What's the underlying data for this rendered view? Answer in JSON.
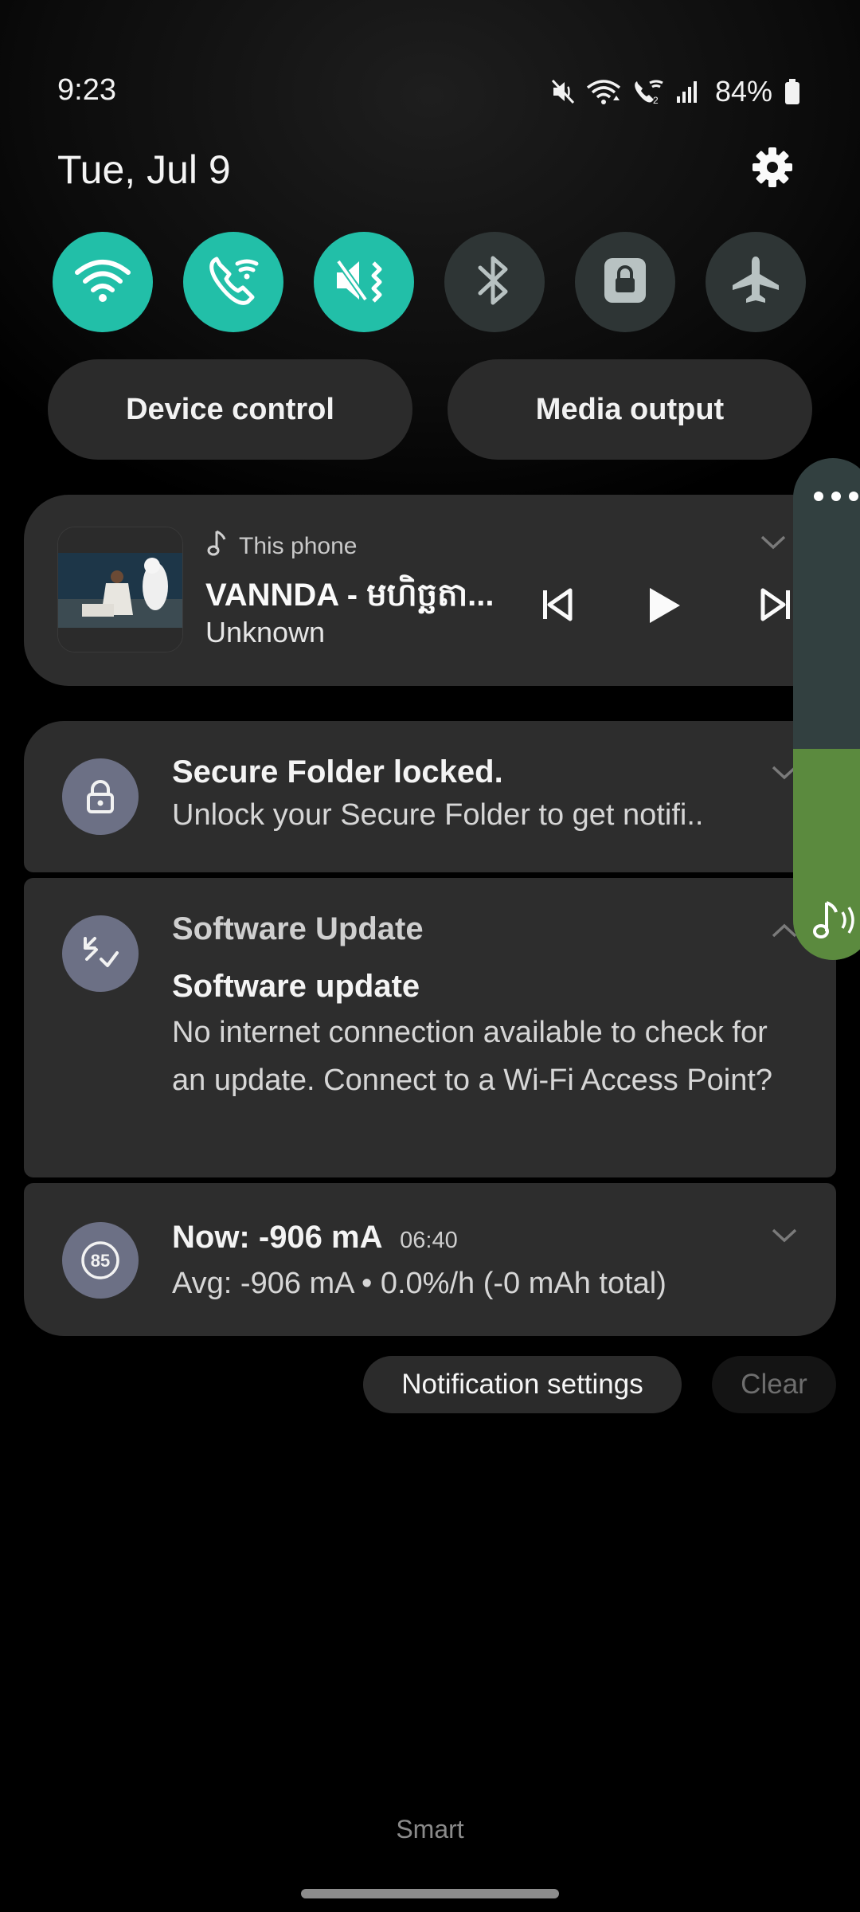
{
  "status_bar": {
    "time": "9:23",
    "battery": "84%",
    "icons": [
      "mute-icon",
      "wifi-icon",
      "wifi-calling-icon",
      "signal-icon",
      "battery-icon"
    ]
  },
  "header": {
    "date": "Tue, Jul 9",
    "settings_icon": "gear-icon"
  },
  "quick_toggles": [
    {
      "name": "Wi-Fi",
      "icon": "wifi-icon",
      "state": "on"
    },
    {
      "name": "Wi-Fi Calling",
      "icon": "wifi-calling-icon",
      "state": "on"
    },
    {
      "name": "Mute",
      "icon": "mute-icon",
      "state": "on"
    },
    {
      "name": "Bluetooth",
      "icon": "bluetooth-icon",
      "state": "off"
    },
    {
      "name": "Secure Folder",
      "icon": "lock-icon",
      "state": "off"
    },
    {
      "name": "Airplane mode",
      "icon": "airplane-icon",
      "state": "off"
    }
  ],
  "buttons": {
    "device_control": "Device control",
    "media_output": "Media output"
  },
  "media": {
    "source": "This phone",
    "title": "VANNDA - មហិច្ឆតា...",
    "artist": "Unknown"
  },
  "notifications": {
    "secure_folder": {
      "title": "Secure Folder locked.",
      "body": "Unlock your Secure Folder to get notifi.."
    },
    "software_update": {
      "app": "Software Update",
      "title": "Software update",
      "body": "No internet connection available to check for an update. Connect to a Wi-Fi Access Point?"
    },
    "battery": {
      "title": "Now: -906 mA",
      "time": "06:40",
      "body": "Avg: -906 mA • 0.0%/h (-0 mAh total)",
      "badge": "85"
    }
  },
  "actions": {
    "notification_settings": "Notification settings",
    "clear": "Clear"
  },
  "footer": {
    "label": "Smart"
  },
  "volume": {
    "level": 0.42,
    "fill_color": "#5b8a3e"
  },
  "colors": {
    "accent": "#22bfa8",
    "toggle_off": "#2e3535",
    "card": "#2d2d2d"
  }
}
